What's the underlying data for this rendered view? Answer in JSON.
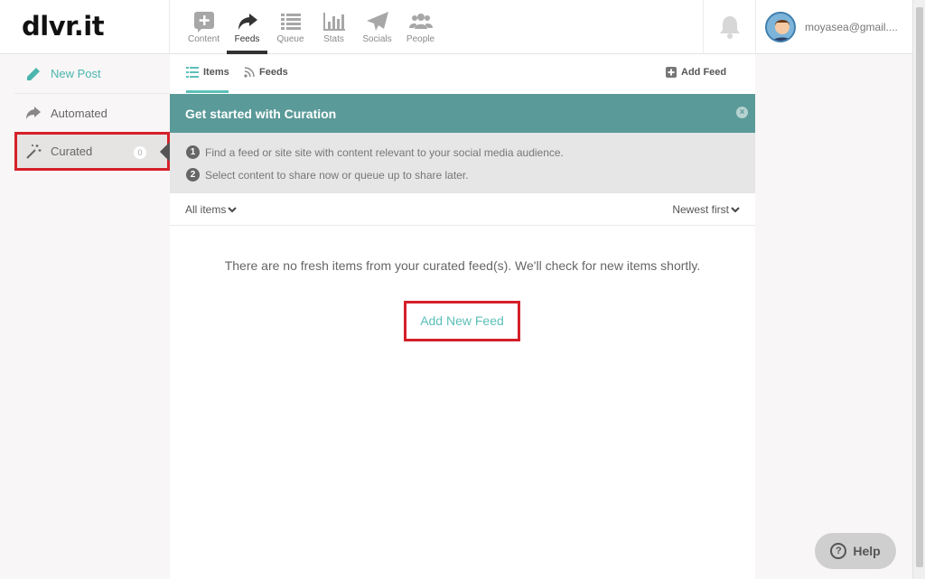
{
  "app": {
    "logo": "dlvr.it"
  },
  "nav": {
    "items": [
      {
        "label": "Content",
        "icon": "plus-square-icon"
      },
      {
        "label": "Feeds",
        "icon": "share-arrow-icon",
        "active": true
      },
      {
        "label": "Queue",
        "icon": "list-icon"
      },
      {
        "label": "Stats",
        "icon": "bar-chart-icon"
      },
      {
        "label": "Socials",
        "icon": "paper-plane-icon"
      },
      {
        "label": "People",
        "icon": "people-icon"
      }
    ]
  },
  "user": {
    "email": "moyasea@gmail...."
  },
  "sidebar": {
    "items": [
      {
        "label": "New Post",
        "icon": "pencil-icon"
      },
      {
        "label": "Automated",
        "icon": "share-arrow-icon"
      },
      {
        "label": "Curated",
        "icon": "magic-wand-icon",
        "badge": "0"
      }
    ]
  },
  "tabs": {
    "items": "Items",
    "feeds": "Feeds",
    "add_feed": "Add Feed"
  },
  "banner": {
    "title": "Get started with Curation",
    "close": "×"
  },
  "steps": [
    {
      "num": "1",
      "text": "Find a feed or site site with content relevant to your social media audience."
    },
    {
      "num": "2",
      "text": "Select content to share now or queue up to share later."
    }
  ],
  "filters": {
    "left": "All items",
    "right": "Newest first"
  },
  "empty": {
    "message": "There are no fresh items from your curated feed(s). We'll check for new items shortly.",
    "action": "Add New Feed"
  },
  "help": {
    "label": "Help",
    "icon_text": "?"
  },
  "colors": {
    "accent": "#5cbfb8",
    "banner": "#5a9a98",
    "highlight": "#d6202a"
  }
}
